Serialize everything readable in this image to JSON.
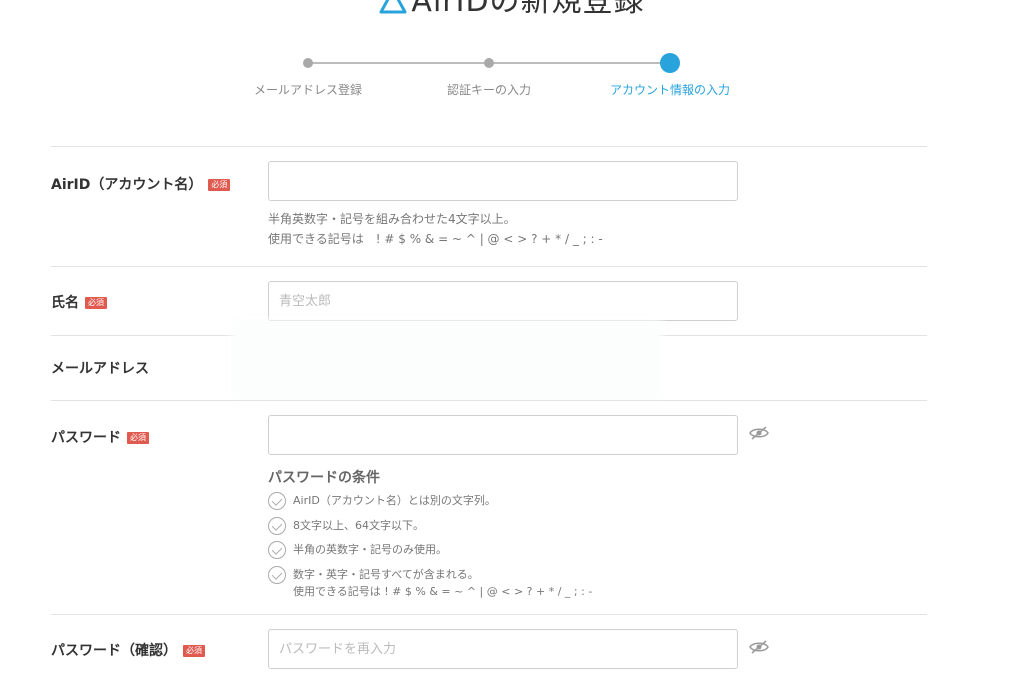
{
  "page": {
    "title": "AirIDの新規登録"
  },
  "stepper": {
    "steps": [
      {
        "label": "メールアドレス登録",
        "state": "done"
      },
      {
        "label": "認証キーの入力",
        "state": "done"
      },
      {
        "label": "アカウント情報の入力",
        "state": "active"
      }
    ]
  },
  "colors": {
    "accent": "#29a3dc",
    "required_badge": "#e05a4f"
  },
  "required_badge": "必須",
  "form": {
    "airid": {
      "label": "AirID（アカウント名）",
      "value": "",
      "placeholder": "",
      "hint_line1": "半角英数字・記号を組み合わせた4文字以上。",
      "hint_line2": "使用できる記号は　! # $ % & = ~ ^ | @ < > ? + * / _ ; : -"
    },
    "name": {
      "label": "氏名",
      "value": "",
      "placeholder": "青空太郎"
    },
    "email": {
      "label": "メールアドレス"
    },
    "password": {
      "label": "パスワード",
      "value": "",
      "placeholder": "",
      "conditions_title": "パスワードの条件",
      "conditions": [
        "AirID（アカウント名）とは別の文字列。",
        "8文字以上、64文字以下。",
        "半角の英数字・記号のみ使用。",
        "数字・英字・記号すべてが含まれる。"
      ],
      "conditions_note": "使用できる記号は ! # $ % & = ~ ^ | @ < > ? + * / _ ; : -"
    },
    "password_confirm": {
      "label": "パスワード（確認）",
      "value": "",
      "placeholder": "パスワードを再入力"
    }
  },
  "icons": {
    "logo": "airid-logo-icon",
    "eye_off": "eye-slash-icon",
    "check": "check-circle-icon"
  }
}
